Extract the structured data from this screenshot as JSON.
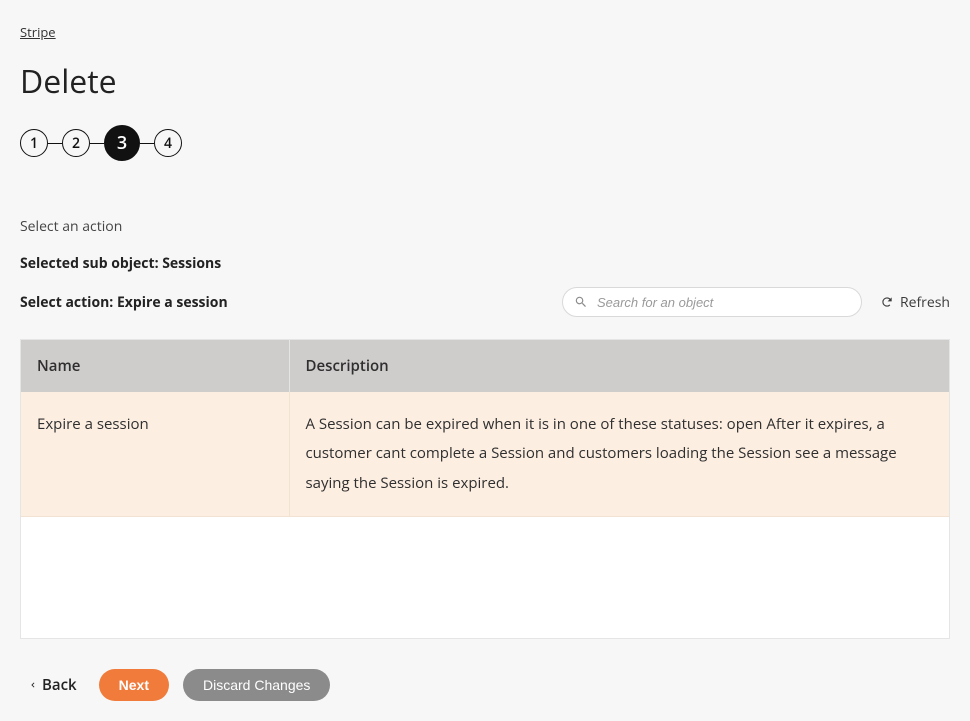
{
  "breadcrumb": {
    "label": "Stripe"
  },
  "page": {
    "title": "Delete"
  },
  "stepper": {
    "steps": [
      {
        "label": "1",
        "active": false
      },
      {
        "label": "2",
        "active": false
      },
      {
        "label": "3",
        "active": true
      },
      {
        "label": "4",
        "active": false
      }
    ]
  },
  "instruction": "Select an action",
  "info": {
    "sub_object": "Selected sub object: Sessions",
    "action": "Select action: Expire a session"
  },
  "search": {
    "placeholder": "Search for an object"
  },
  "refresh_label": "Refresh",
  "table": {
    "headers": {
      "name": "Name",
      "description": "Description"
    },
    "rows": [
      {
        "name": "Expire a session",
        "description": "A Session can be expired when it is in one of these statuses: open After it expires, a customer cant complete a Session and customers loading the Session see a message saying the Session is expired."
      }
    ]
  },
  "footer": {
    "back": "Back",
    "next": "Next",
    "discard": "Discard Changes"
  }
}
